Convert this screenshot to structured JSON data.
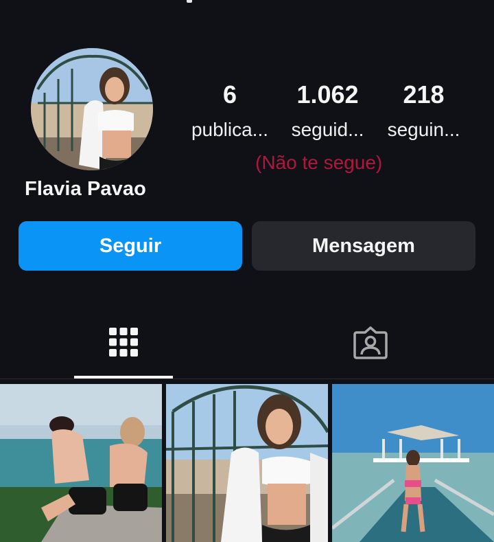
{
  "profile": {
    "name": "Flavia Pavao"
  },
  "stats": {
    "posts": {
      "count": "6",
      "label": "publica..."
    },
    "followers": {
      "count": "1.062",
      "label": "seguid..."
    },
    "following": {
      "count": "218",
      "label": "seguin..."
    },
    "not_following_note": "(Não te segue)"
  },
  "actions": {
    "follow_label": "Seguir",
    "message_label": "Mensagem"
  },
  "tabs": [
    {
      "icon": "grid-icon",
      "active": true
    },
    {
      "icon": "tagged-person-icon",
      "active": false
    }
  ],
  "colors": {
    "background": "#0f1116",
    "follow_button": "#0a95f6",
    "message_button": "#26282d",
    "not_following_text": "#b0173e"
  },
  "posts": [
    {
      "id": "post-1"
    },
    {
      "id": "post-2"
    },
    {
      "id": "post-3"
    }
  ]
}
